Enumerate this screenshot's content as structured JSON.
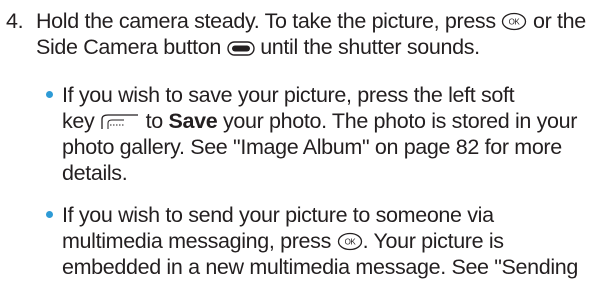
{
  "step": {
    "number": "4.",
    "line1": "Hold the camera steady. To take the picture, press",
    "line1_after_ok": "or the",
    "line2_before_icon": "Side Camera button",
    "line2_after_icon": "until the shutter sounds."
  },
  "bullets": [
    {
      "line1": "If you wish to save your picture, press the left soft",
      "key_prefix": "key",
      "to_text": "to",
      "save_label": "Save",
      "after_save": "your photo. The photo is stored in your photo gallery. See \"Image Album\" on page 82 for more details."
    },
    {
      "before_ok": "If you wish to send your picture to someone via multimedia messaging, press",
      "after_ok": ". Your picture is embedded in a new multimedia message. See \"Sending"
    }
  ],
  "icons": {
    "ok_key": "ok-key-icon",
    "side_camera_button": "side-camera-button-icon",
    "left_soft_key": "left-soft-key-icon"
  },
  "colors": {
    "text": "#231f20",
    "bullet": "#2e9bd6"
  }
}
